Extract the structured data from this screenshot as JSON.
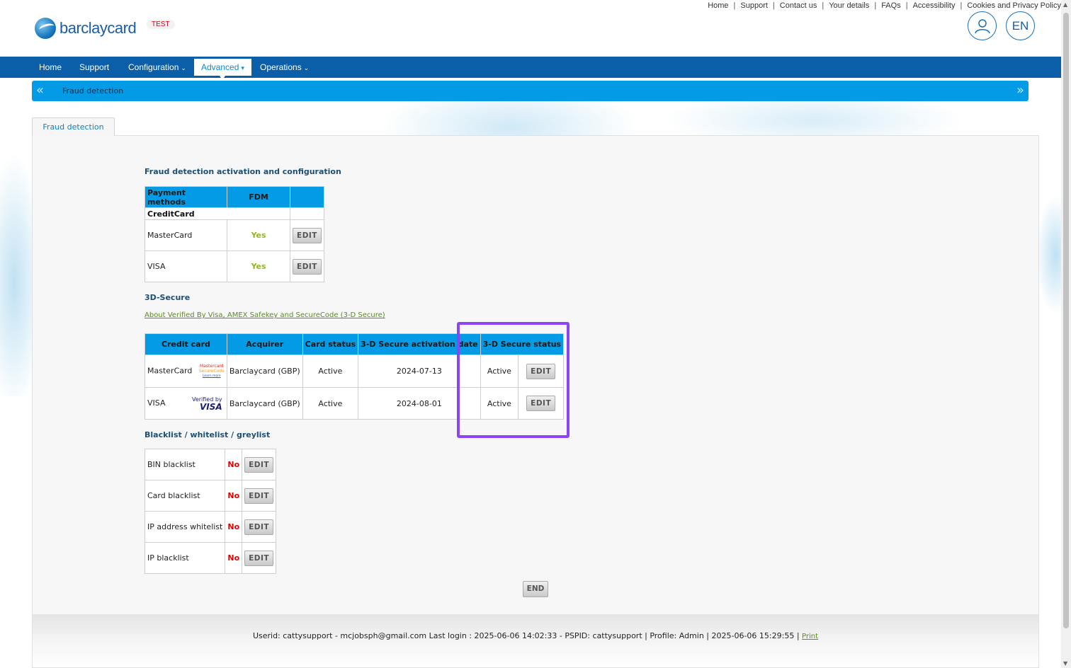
{
  "header": {
    "top_links": [
      "Home",
      "Support",
      "Contact us",
      "Your details",
      "FAQs",
      "Accessibility",
      "Cookies and Privacy Policy"
    ],
    "logo_text": "barclaycard",
    "env_badge": "TEST",
    "lang": "EN"
  },
  "nav": {
    "items": [
      {
        "label": "Home"
      },
      {
        "label": "Support"
      },
      {
        "label": "Configuration"
      },
      {
        "label": "Advanced"
      },
      {
        "label": "Operations"
      }
    ],
    "active": "Advanced"
  },
  "breadcrumb": {
    "current": "Fraud detection"
  },
  "tab": {
    "label": "Fraud detection"
  },
  "fdm": {
    "title": "Fraud detection activation and configuration",
    "headers": [
      "Payment methods",
      "FDM",
      ""
    ],
    "group": "CreditCard",
    "rows": [
      {
        "method": "MasterCard",
        "fdm": "Yes",
        "action": "EDIT"
      },
      {
        "method": "VISA",
        "fdm": "Yes",
        "action": "EDIT"
      }
    ]
  },
  "secure3d": {
    "title": "3D-Secure",
    "link": "About Verified By Visa, AMEX Safekey and SecureCode (3-D Secure)",
    "headers": [
      "Credit card",
      "Acquirer",
      "Card status",
      "3-D Secure activation date",
      "3-D Secure status"
    ],
    "rows": [
      {
        "card": "MasterCard",
        "logo_l1": "Mastercard",
        "logo_l2": "SecureCode",
        "logo_l3": "Learn more",
        "acquirer": "Barclaycard (GBP)",
        "card_status": "Active",
        "activation_date": "2024-07-13",
        "status": "Active",
        "action": "EDIT"
      },
      {
        "card": "VISA",
        "logo_l1": "Verified by",
        "logo_l2": "VISA",
        "acquirer": "Barclaycard (GBP)",
        "card_status": "Active",
        "activation_date": "2024-08-01",
        "status": "Active",
        "action": "EDIT"
      }
    ]
  },
  "lists": {
    "title": "Blacklist / whitelist / greylist",
    "rows": [
      {
        "label": "BIN blacklist",
        "value": "No",
        "action": "EDIT"
      },
      {
        "label": "Card blacklist",
        "value": "No",
        "action": "EDIT"
      },
      {
        "label": "IP address whitelist",
        "value": "No",
        "action": "EDIT"
      },
      {
        "label": "IP blacklist",
        "value": "No",
        "action": "EDIT"
      }
    ]
  },
  "end_button": "END",
  "footer": {
    "text": "Userid: cattysupport - mcjobsph@gmail.com Last login : 2025-06-06 14:02:33 - PSPID: cattysupport | Profile: Admin | 2025-06-06 15:29:55 |",
    "print": "Print"
  },
  "colors": {
    "nav_bg": "#0b5ea8",
    "accent": "#039be5",
    "yes": "#8fb61f",
    "no": "#e00000",
    "highlight": "#8b45f3"
  }
}
